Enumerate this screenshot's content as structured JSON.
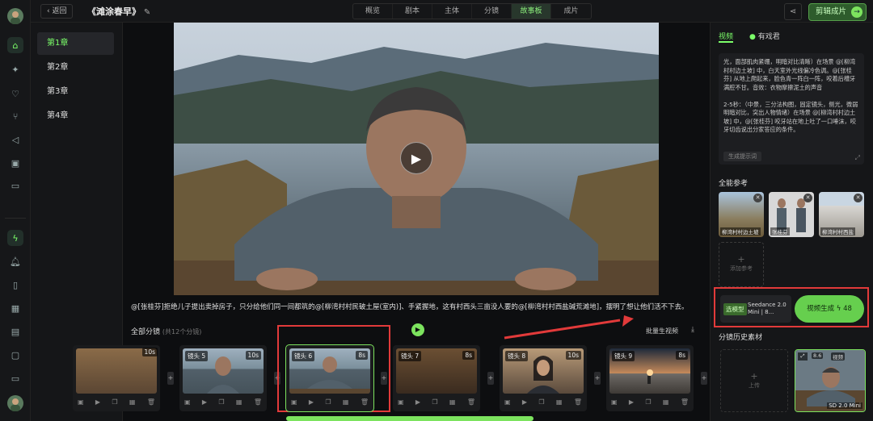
{
  "header": {
    "back_label": "‹ 返回",
    "project_title": "《滩涂春早》",
    "tabs": [
      "概览",
      "剧本",
      "主体",
      "分镜",
      "故事板",
      "成片"
    ],
    "active_tab": "故事板",
    "edit_button": "剪辑成片"
  },
  "chapters": [
    "第1章",
    "第2章",
    "第3章",
    "第4章"
  ],
  "main": {
    "caption": "@[张桂芬]拒绝儿子提出卖掉房子，只分给他们同一间都筑的@[柳湾村村民破土屋(室内)]、手紧握地，这有村西头三亩没人要的@[柳湾村村西盐碱荒滩地]，摆明了想让他们活不下去。",
    "section_title": "全部分镜",
    "section_count": "(共12个分镜)",
    "batch_label": "批量生视频",
    "shots": [
      {
        "label": "",
        "duration": "10s"
      },
      {
        "label": "镜头 5",
        "duration": "10s"
      },
      {
        "label": "镜头 6",
        "duration": "8s"
      },
      {
        "label": "镜头 7",
        "duration": "8s"
      },
      {
        "label": "镜头 8",
        "duration": "10s"
      },
      {
        "label": "镜头 9",
        "duration": "8s"
      }
    ]
  },
  "right": {
    "tab_video": "视频",
    "tab_other": "有戏君",
    "prompt_text": "光，面部肌肉紧绷，明暗对比清晰）在场景 @[柳湾村村边土坡] 中，白天室外光线偏冷色调。@[张桂芬] 从地上爬起来，脸色青一阵白一阵，咬着后槽牙满腔不甘。音效：衣物摩擦泥土的声音\n\n2-5秒：（中景，三分法构图，固定镜头，侧光，微弱明暗对比，突出人物情绪）在场景 @[柳湾村村边土坡] 中，@[张桂芬] 咬牙站在地上吐了一口唾沫，咬牙切齿说出分家答应的条件。",
    "prompt_button": "生成提示词",
    "refs_title": "全能参考",
    "refs": [
      "柳湾村村边土坡",
      "张桂芬",
      "柳湾村村西盐"
    ],
    "add_ref": "添加参考",
    "model_tag": "选模型",
    "model_name": "Seedance 2.0 Mini | 8...",
    "generate_label": "视频生成",
    "generate_cost": "48",
    "history_title": "分镜历史素材",
    "history_add": "上传",
    "history_version": "SD 2.0 Mini",
    "history_tags": [
      "8.6",
      "视频"
    ]
  }
}
